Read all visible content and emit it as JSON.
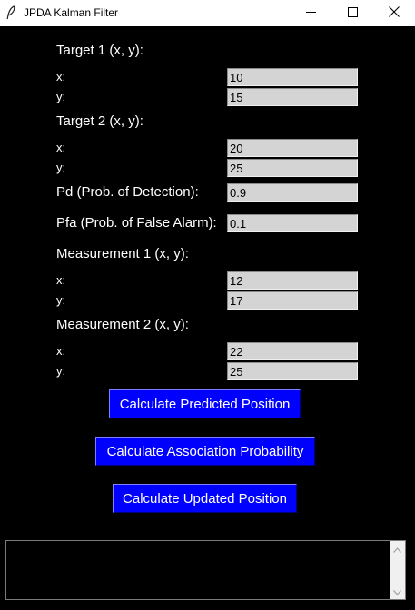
{
  "window": {
    "title": "JPDA Kalman Filter",
    "background_color": "#000000",
    "icons": {
      "app": "feather-icon",
      "minimize": "minimize-icon",
      "maximize": "maximize-icon",
      "close": "close-icon"
    }
  },
  "target1": {
    "heading": "Target 1 (x, y):",
    "x_label": "x:",
    "x_value": "10",
    "y_label": "y:",
    "y_value": "15"
  },
  "target2": {
    "heading": "Target 2 (x, y):",
    "x_label": "x:",
    "x_value": "20",
    "y_label": "y:",
    "y_value": "25"
  },
  "pd": {
    "label": "Pd (Prob. of Detection):",
    "value": "0.9"
  },
  "pfa": {
    "label": "Pfa (Prob. of False Alarm):",
    "value": "0.1"
  },
  "measurement1": {
    "heading": "Measurement 1 (x, y):",
    "x_label": "x:",
    "x_value": "12",
    "y_label": "y:",
    "y_value": "17"
  },
  "measurement2": {
    "heading": "Measurement 2 (x, y):",
    "x_label": "x:",
    "x_value": "22",
    "y_label": "y:",
    "y_value": "25"
  },
  "buttons": {
    "predicted": "Calculate Predicted Position",
    "association": "Calculate Association Probability",
    "updated": "Calculate Updated Position",
    "color": "#0000ff"
  },
  "output": {
    "text": ""
  }
}
